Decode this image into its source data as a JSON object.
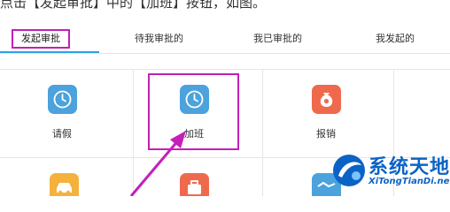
{
  "caption": "点击【发起审批】中的【加班】按钮，如图。",
  "tabs": [
    {
      "label": "发起审批"
    },
    {
      "label": "待我审批的"
    },
    {
      "label": "我已审批的"
    },
    {
      "label": "我发起的"
    }
  ],
  "active_tab": "发起审批",
  "grid": {
    "row1": [
      {
        "label": "请假",
        "icon": "clock-icon",
        "color": "#4ba2dc"
      },
      {
        "label": "加班",
        "icon": "clock-icon",
        "color": "#4ba2dc"
      },
      {
        "label": "报销",
        "icon": "money-bag-icon",
        "color": "#ef6a4d"
      }
    ],
    "row2": [
      {
        "label": "",
        "icon": "car-icon",
        "color": "#f4b23d"
      },
      {
        "label": "",
        "icon": "briefcase-icon",
        "color": "#ef6a4d"
      },
      {
        "label": "",
        "icon": "handshake-icon",
        "color": "#4ba2dc"
      }
    ]
  },
  "watermark": {
    "title": "系统天地",
    "url": "XiTongTianDi.net"
  },
  "colors": {
    "highlight": "#c41fb8",
    "tab_accent": "#2ea0e6",
    "watermark": "#0b63c6"
  }
}
